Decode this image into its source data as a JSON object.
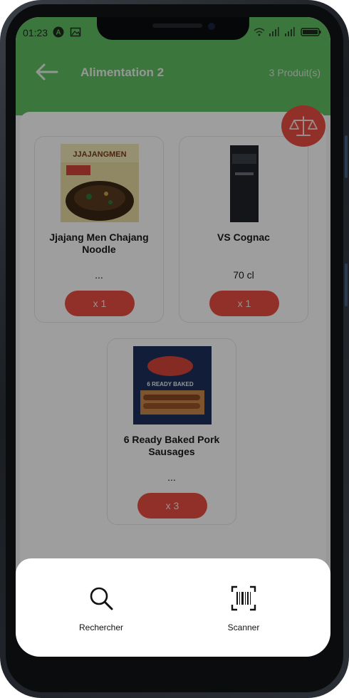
{
  "status_bar": {
    "time": "01:23"
  },
  "header": {
    "title": "Alimentation 2",
    "product_count": "3 Produit(s)"
  },
  "products": [
    {
      "name": "Jjajang Men Chajang Noodle",
      "quantity": "...",
      "count": "x 1",
      "image_text": "JJAJANGMEN"
    },
    {
      "name": "VS Cognac",
      "quantity": "70 cl",
      "count": "x 1",
      "image_text": ""
    },
    {
      "name": "6 Ready Baked Pork Sausages",
      "quantity": "...",
      "count": "x 3",
      "image_text": "6 READY BAKED"
    }
  ],
  "bottom_sheet": {
    "search_label": "Rechercher",
    "scan_label": "Scanner"
  },
  "colors": {
    "primary": "#5fbf63",
    "accent": "#ea4e43"
  },
  "icons": [
    "back-arrow-icon",
    "scale-icon",
    "search-icon",
    "barcode-scan-icon"
  ]
}
